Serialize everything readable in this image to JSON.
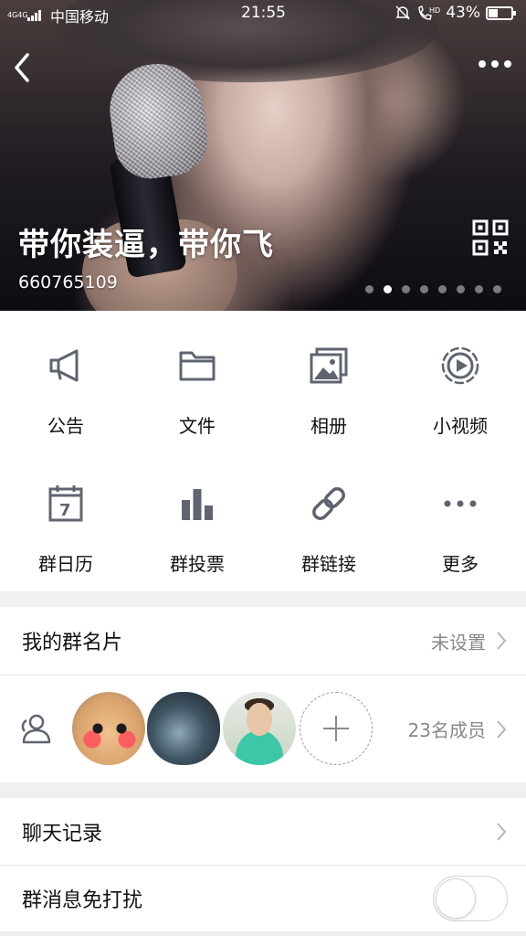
{
  "status_bar": {
    "network_type": "4G4G",
    "carrier": "中国移动",
    "time": "21:55",
    "battery": "43%",
    "battery_level": 0.43
  },
  "header": {
    "group_name": "带你装逼，带你飞",
    "group_id": "660765109",
    "carousel_pages": 8,
    "carousel_active_index": 1
  },
  "features": [
    {
      "label": "公告",
      "icon": "megaphone-icon"
    },
    {
      "label": "文件",
      "icon": "folder-icon"
    },
    {
      "label": "相册",
      "icon": "photo-album-icon"
    },
    {
      "label": "小视频",
      "icon": "video-play-icon"
    },
    {
      "label": "群日历",
      "icon": "calendar-icon"
    },
    {
      "label": "群投票",
      "icon": "bar-chart-icon"
    },
    {
      "label": "群链接",
      "icon": "link-icon"
    },
    {
      "label": "更多",
      "icon": "more-dots-icon"
    }
  ],
  "my_group_card": {
    "label": "我的群名片",
    "value": "未设置"
  },
  "members": {
    "count_label": "23名成员"
  },
  "chat_history": {
    "label": "聊天记录"
  },
  "do_not_disturb": {
    "label": "群消息免打扰",
    "enabled": false
  },
  "colors": {
    "icon_gray": "#5f6470",
    "background": "#f0f0f2",
    "divider": "#e5e5e8"
  }
}
